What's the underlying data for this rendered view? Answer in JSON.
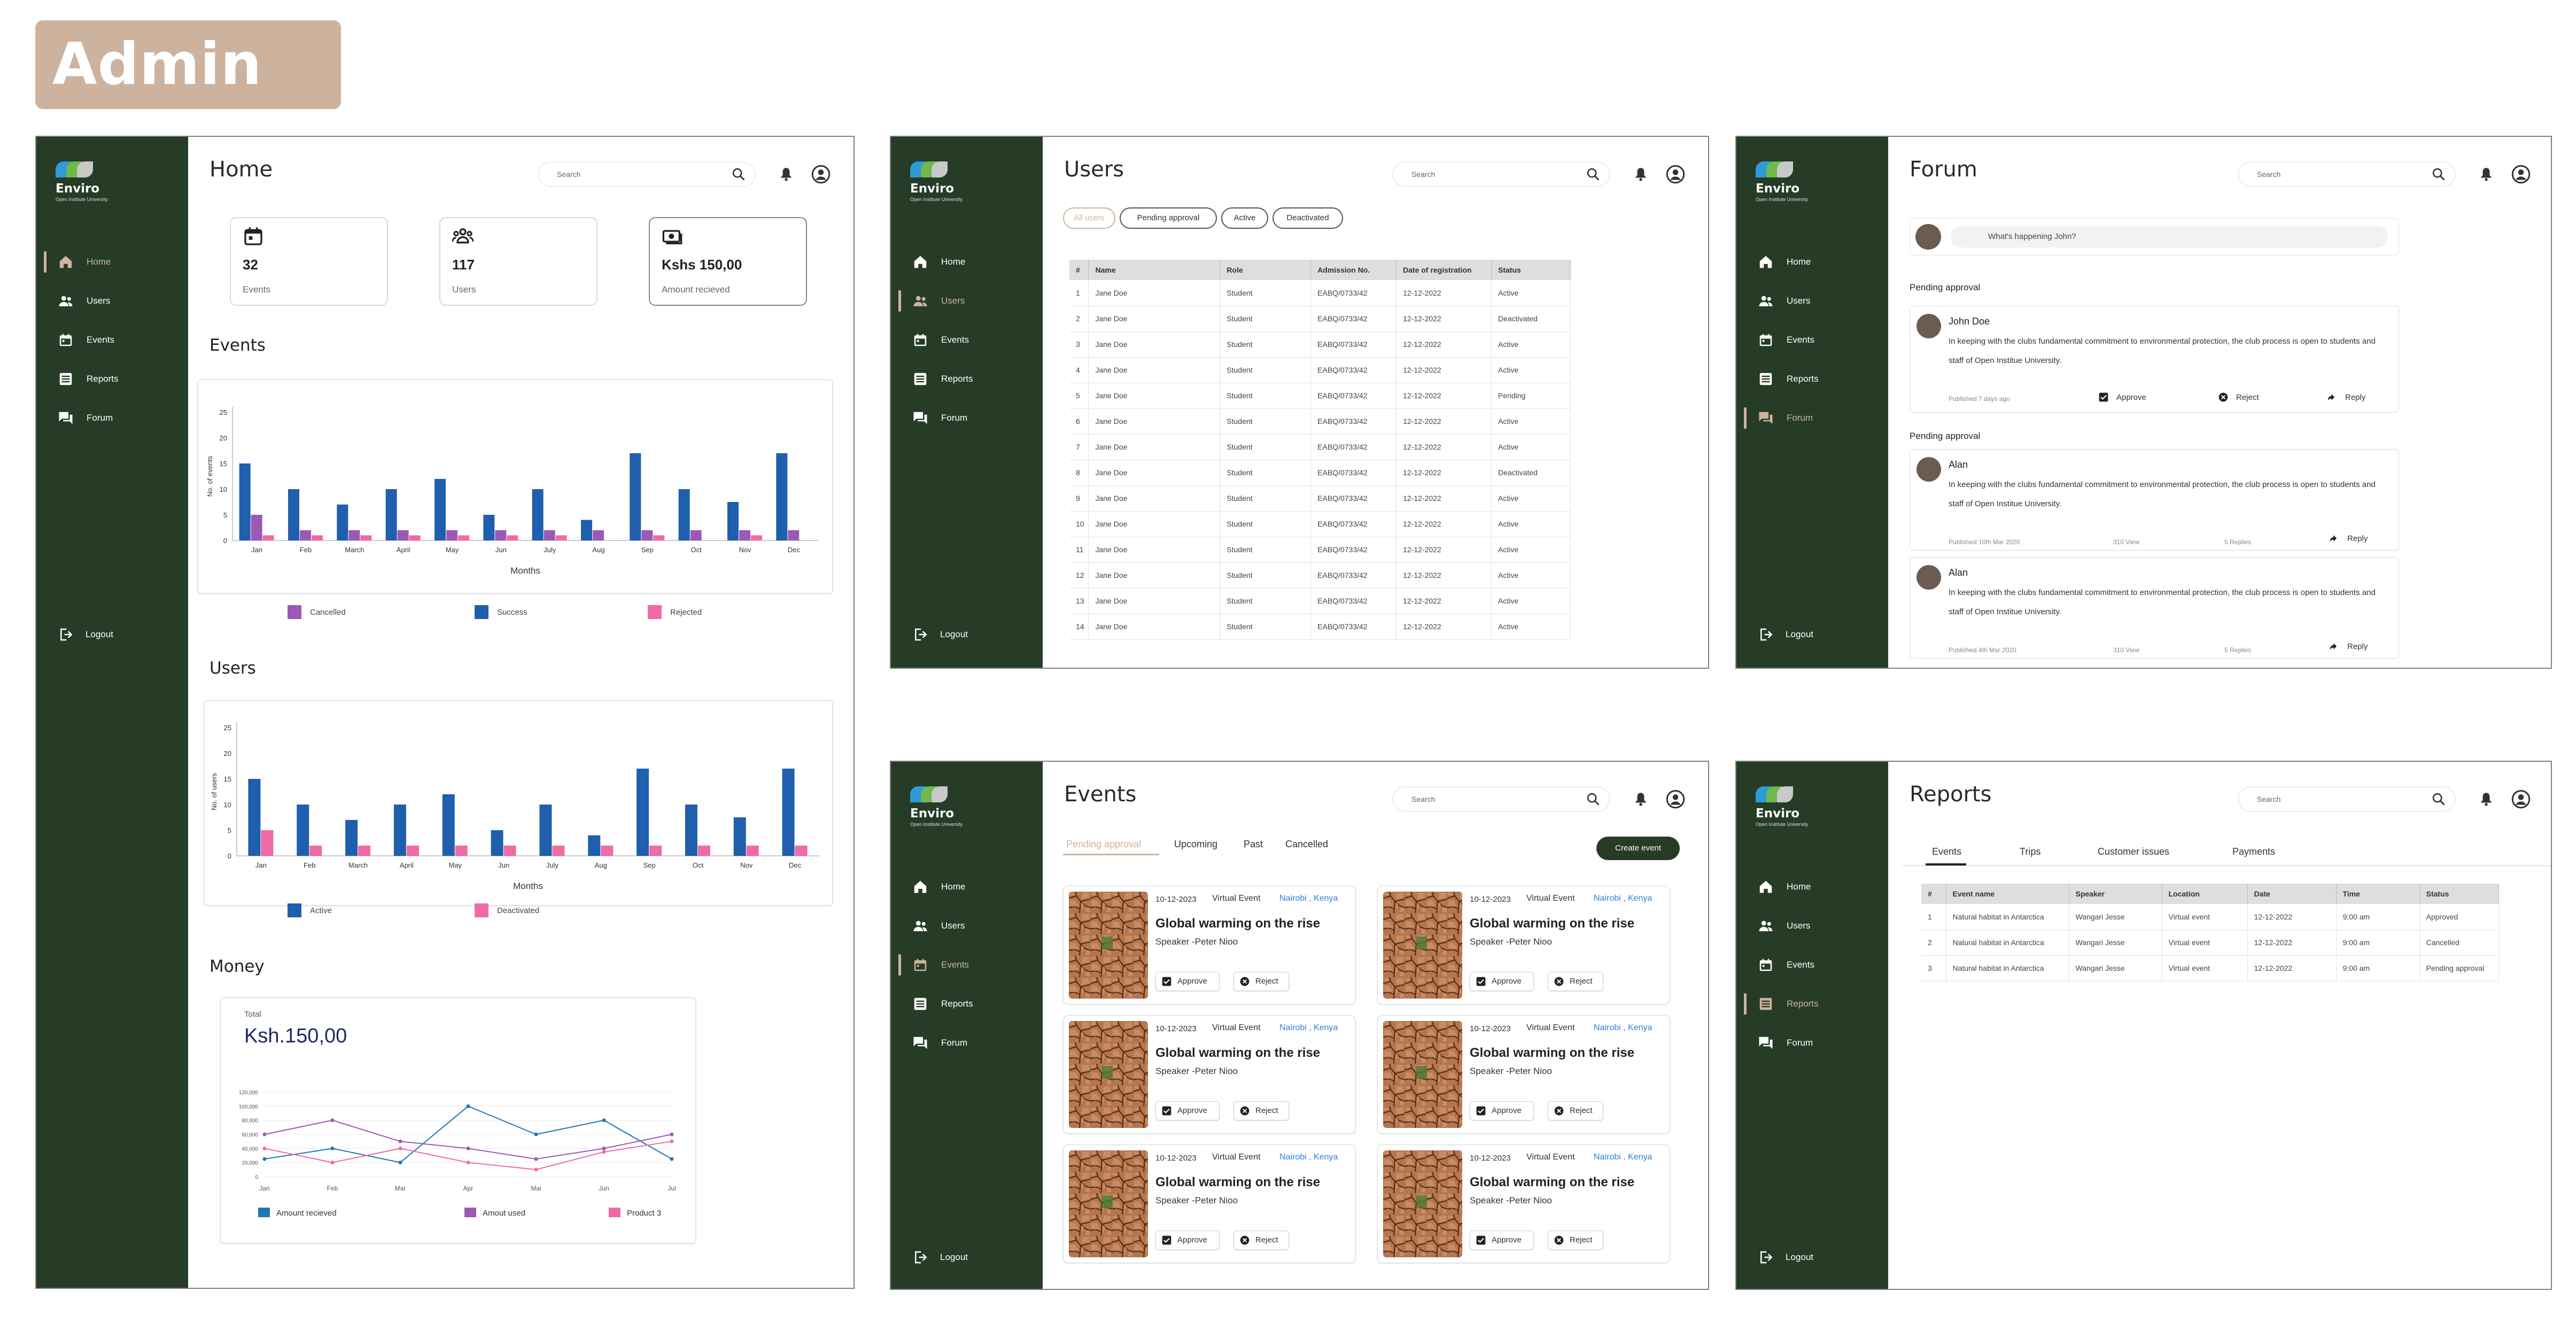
{
  "badge": "Admin",
  "brand": {
    "name": "Enviro",
    "tagline": "Open Institute University"
  },
  "nav": {
    "home": "Home",
    "users": "Users",
    "events": "Events",
    "reports": "Reports",
    "forum": "Forum",
    "logout": "Logout"
  },
  "search_placeholder": "Search",
  "colors": {
    "sidebar": "#263c27",
    "accent": "#cdb39e",
    "success": "#1f5fad",
    "cancelled": "#9b59b6",
    "rejected": "#f06aa8",
    "link": "#2f7fd8"
  },
  "home": {
    "title": "Home",
    "stats": [
      {
        "icon": "calendar-icon",
        "value": "32",
        "label": "Events"
      },
      {
        "icon": "users-icon",
        "value": "117",
        "label": "Users"
      },
      {
        "icon": "cash-icon",
        "value": "Kshs 150,00",
        "label": "Amount recieved"
      }
    ],
    "events_title": "Events",
    "users_title": "Users",
    "money_title": "Money",
    "money_total_label": "Total",
    "money_total_value": "Ksh.150,00"
  },
  "chart_data": [
    {
      "type": "bar",
      "title": "Events",
      "xlabel": "Months",
      "ylabel": "No. of events",
      "ylim": [
        0,
        25
      ],
      "yticks": [
        0,
        5,
        10,
        15,
        20,
        25
      ],
      "categories": [
        "Jan",
        "Feb",
        "March",
        "April",
        "May",
        "Jun",
        "July",
        "Aug",
        "Sep",
        "Oct",
        "Nov",
        "Dec"
      ],
      "series": [
        {
          "name": "Success",
          "color": "#1f5fad",
          "values": [
            15,
            10,
            7,
            10,
            12,
            5,
            10,
            4,
            17,
            10,
            7.5,
            17
          ]
        },
        {
          "name": "Cancelled",
          "color": "#9b59b6",
          "values": [
            5,
            2,
            2,
            2,
            2,
            2,
            2,
            2,
            2,
            2,
            2,
            2
          ]
        },
        {
          "name": "Rejected",
          "color": "#f06aa8",
          "values": [
            1,
            1,
            1,
            1,
            1,
            1,
            1,
            0,
            1,
            0,
            1,
            0
          ]
        }
      ],
      "legend": [
        "Cancelled",
        "Success",
        "Rejected"
      ]
    },
    {
      "type": "bar",
      "title": "Users",
      "xlabel": "Months",
      "ylabel": "No. of users",
      "ylim": [
        0,
        25
      ],
      "yticks": [
        0,
        5,
        10,
        15,
        20,
        25
      ],
      "categories": [
        "Jan",
        "Feb",
        "March",
        "April",
        "May",
        "Jun",
        "July",
        "Aug",
        "Sep",
        "Oct",
        "Nov",
        "Dec"
      ],
      "series": [
        {
          "name": "Active",
          "color": "#1f5fad",
          "values": [
            15,
            10,
            7,
            10,
            12,
            5,
            10,
            4,
            17,
            10,
            7.5,
            17
          ]
        },
        {
          "name": "Deactivated",
          "color": "#f06aa8",
          "values": [
            5,
            2,
            2,
            2,
            2,
            2,
            2,
            2,
            2,
            2,
            2,
            2
          ]
        }
      ],
      "legend": [
        "Active",
        "Deactivated"
      ]
    },
    {
      "type": "line",
      "title": "Money",
      "ylim": [
        0,
        120000
      ],
      "yticks": [
        "0",
        "20,000",
        "40,000",
        "60,000",
        "80,000",
        "100,000",
        "120,000"
      ],
      "categories": [
        "Jan",
        "Feb",
        "Mar",
        "Apr",
        "Mai",
        "Jun",
        "Jul"
      ],
      "series": [
        {
          "name": "Amount recieved",
          "color": "#1f77b4",
          "values": [
            25000,
            40000,
            20000,
            100000,
            60000,
            80000,
            25000
          ]
        },
        {
          "name": "Amout used",
          "color": "#9b59b6",
          "values": [
            60000,
            80000,
            50000,
            40000,
            25000,
            40000,
            60000
          ]
        },
        {
          "name": "Product 3",
          "color": "#f06aa8",
          "values": [
            40000,
            20000,
            40000,
            20000,
            10000,
            35000,
            50000
          ]
        }
      ]
    }
  ],
  "users_page": {
    "title": "Users",
    "filters": [
      "All users",
      "Pending approval",
      "Active",
      "Deactivated"
    ],
    "columns": [
      "#",
      "Name",
      "Role",
      "Admission No.",
      "Date of registration",
      "Status"
    ],
    "rows": [
      [
        "1",
        "Jane Doe",
        "Student",
        "EABQ/0733/42",
        "12-12-2022",
        "Active"
      ],
      [
        "2",
        "Jane Doe",
        "Student",
        "EABQ/0733/42",
        "12-12-2022",
        "Deactivated"
      ],
      [
        "3",
        "Jane Doe",
        "Student",
        "EABQ/0733/42",
        "12-12-2022",
        "Active"
      ],
      [
        "4",
        "Jane Doe",
        "Student",
        "EABQ/0733/42",
        "12-12-2022",
        "Active"
      ],
      [
        "5",
        "Jane Doe",
        "Student",
        "EABQ/0733/42",
        "12-12-2022",
        "Pending"
      ],
      [
        "6",
        "Jane Doe",
        "Student",
        "EABQ/0733/42",
        "12-12-2022",
        "Active"
      ],
      [
        "7",
        "Jane Doe",
        "Student",
        "EABQ/0733/42",
        "12-12-2022",
        "Active"
      ],
      [
        "8",
        "Jane Doe",
        "Student",
        "EABQ/0733/42",
        "12-12-2022",
        "Deactivated"
      ],
      [
        "9",
        "Jane Doe",
        "Student",
        "EABQ/0733/42",
        "12-12-2022",
        "Active"
      ],
      [
        "10",
        "Jane Doe",
        "Student",
        "EABQ/0733/42",
        "12-12-2022",
        "Active"
      ],
      [
        "11",
        "Jane Doe",
        "Student",
        "EABQ/0733/42",
        "12-12-2022",
        "Active"
      ],
      [
        "12",
        "Jane Doe",
        "Student",
        "EABQ/0733/42",
        "12-12-2022",
        "Active"
      ],
      [
        "13",
        "Jane Doe",
        "Student",
        "EABQ/0733/42",
        "12-12-2022",
        "Active"
      ],
      [
        "14",
        "Jane Doe",
        "Student",
        "EABQ/0733/42",
        "12-12-2022",
        "Active"
      ]
    ]
  },
  "forum_page": {
    "title": "Forum",
    "composer_placeholder": "What's happening John?",
    "sections": [
      "Pending approval",
      "Pending approval"
    ],
    "posts": [
      {
        "author": "John Doe",
        "text": "In keeping with the clubs fundamental commitment to environmental protection, the club process is open to students and staff of Open Institue University.",
        "published": "Published 7 days ago",
        "approve": "Approve",
        "reject": "Reject",
        "reply": "Reply"
      },
      {
        "author": "Alan",
        "text": "In keeping with the clubs fundamental commitment to environmental protection, the club process is open to students and staff of Open Institue University.",
        "published": "Published 10th Mar 2020",
        "views": "310 View",
        "replies": "5 Replies",
        "reply": "Reply"
      },
      {
        "author": "Alan",
        "text": "In keeping with the clubs fundamental commitment to environmental protection, the club process is open to students and staff of Open Institue University.",
        "published": "Published 4th Mar 2020",
        "views": "310 View",
        "replies": "5 Replies",
        "reply": "Reply"
      }
    ]
  },
  "events_page": {
    "title": "Events",
    "tabs": [
      "Pending approval",
      "Upcoming",
      "Past",
      "Cancelled"
    ],
    "create_button": "Create event",
    "card": {
      "date": "10-12-2023",
      "type": "Virtual Event",
      "location": "Nairobi , Kenya",
      "title": "Global warming on the rise",
      "speaker": "Speaker -Peter Nioo",
      "approve": "Approve",
      "reject": "Reject"
    }
  },
  "reports_page": {
    "title": "Reports",
    "tabs": [
      "Events",
      "Trips",
      "Customer issues",
      "Payments"
    ],
    "columns": [
      "#",
      "Event name",
      "Speaker",
      "Location",
      "Date",
      "Time",
      "Status"
    ],
    "rows": [
      [
        "1",
        "Natural habitat in Antarctica",
        "Wangari Jesse",
        "Virtual event",
        "12-12-2022",
        "9:00 am",
        "Approved"
      ],
      [
        "2",
        "Natural habitat in Antarctica",
        "Wangari Jesse",
        "Virtual event",
        "12-12-2022",
        "9:00 am",
        "Cancelled"
      ],
      [
        "3",
        "Natural habitat in Antarctica",
        "Wangari Jesse",
        "Virtual event",
        "12-12-2022",
        "9:00 am",
        "Pending approval"
      ]
    ]
  }
}
